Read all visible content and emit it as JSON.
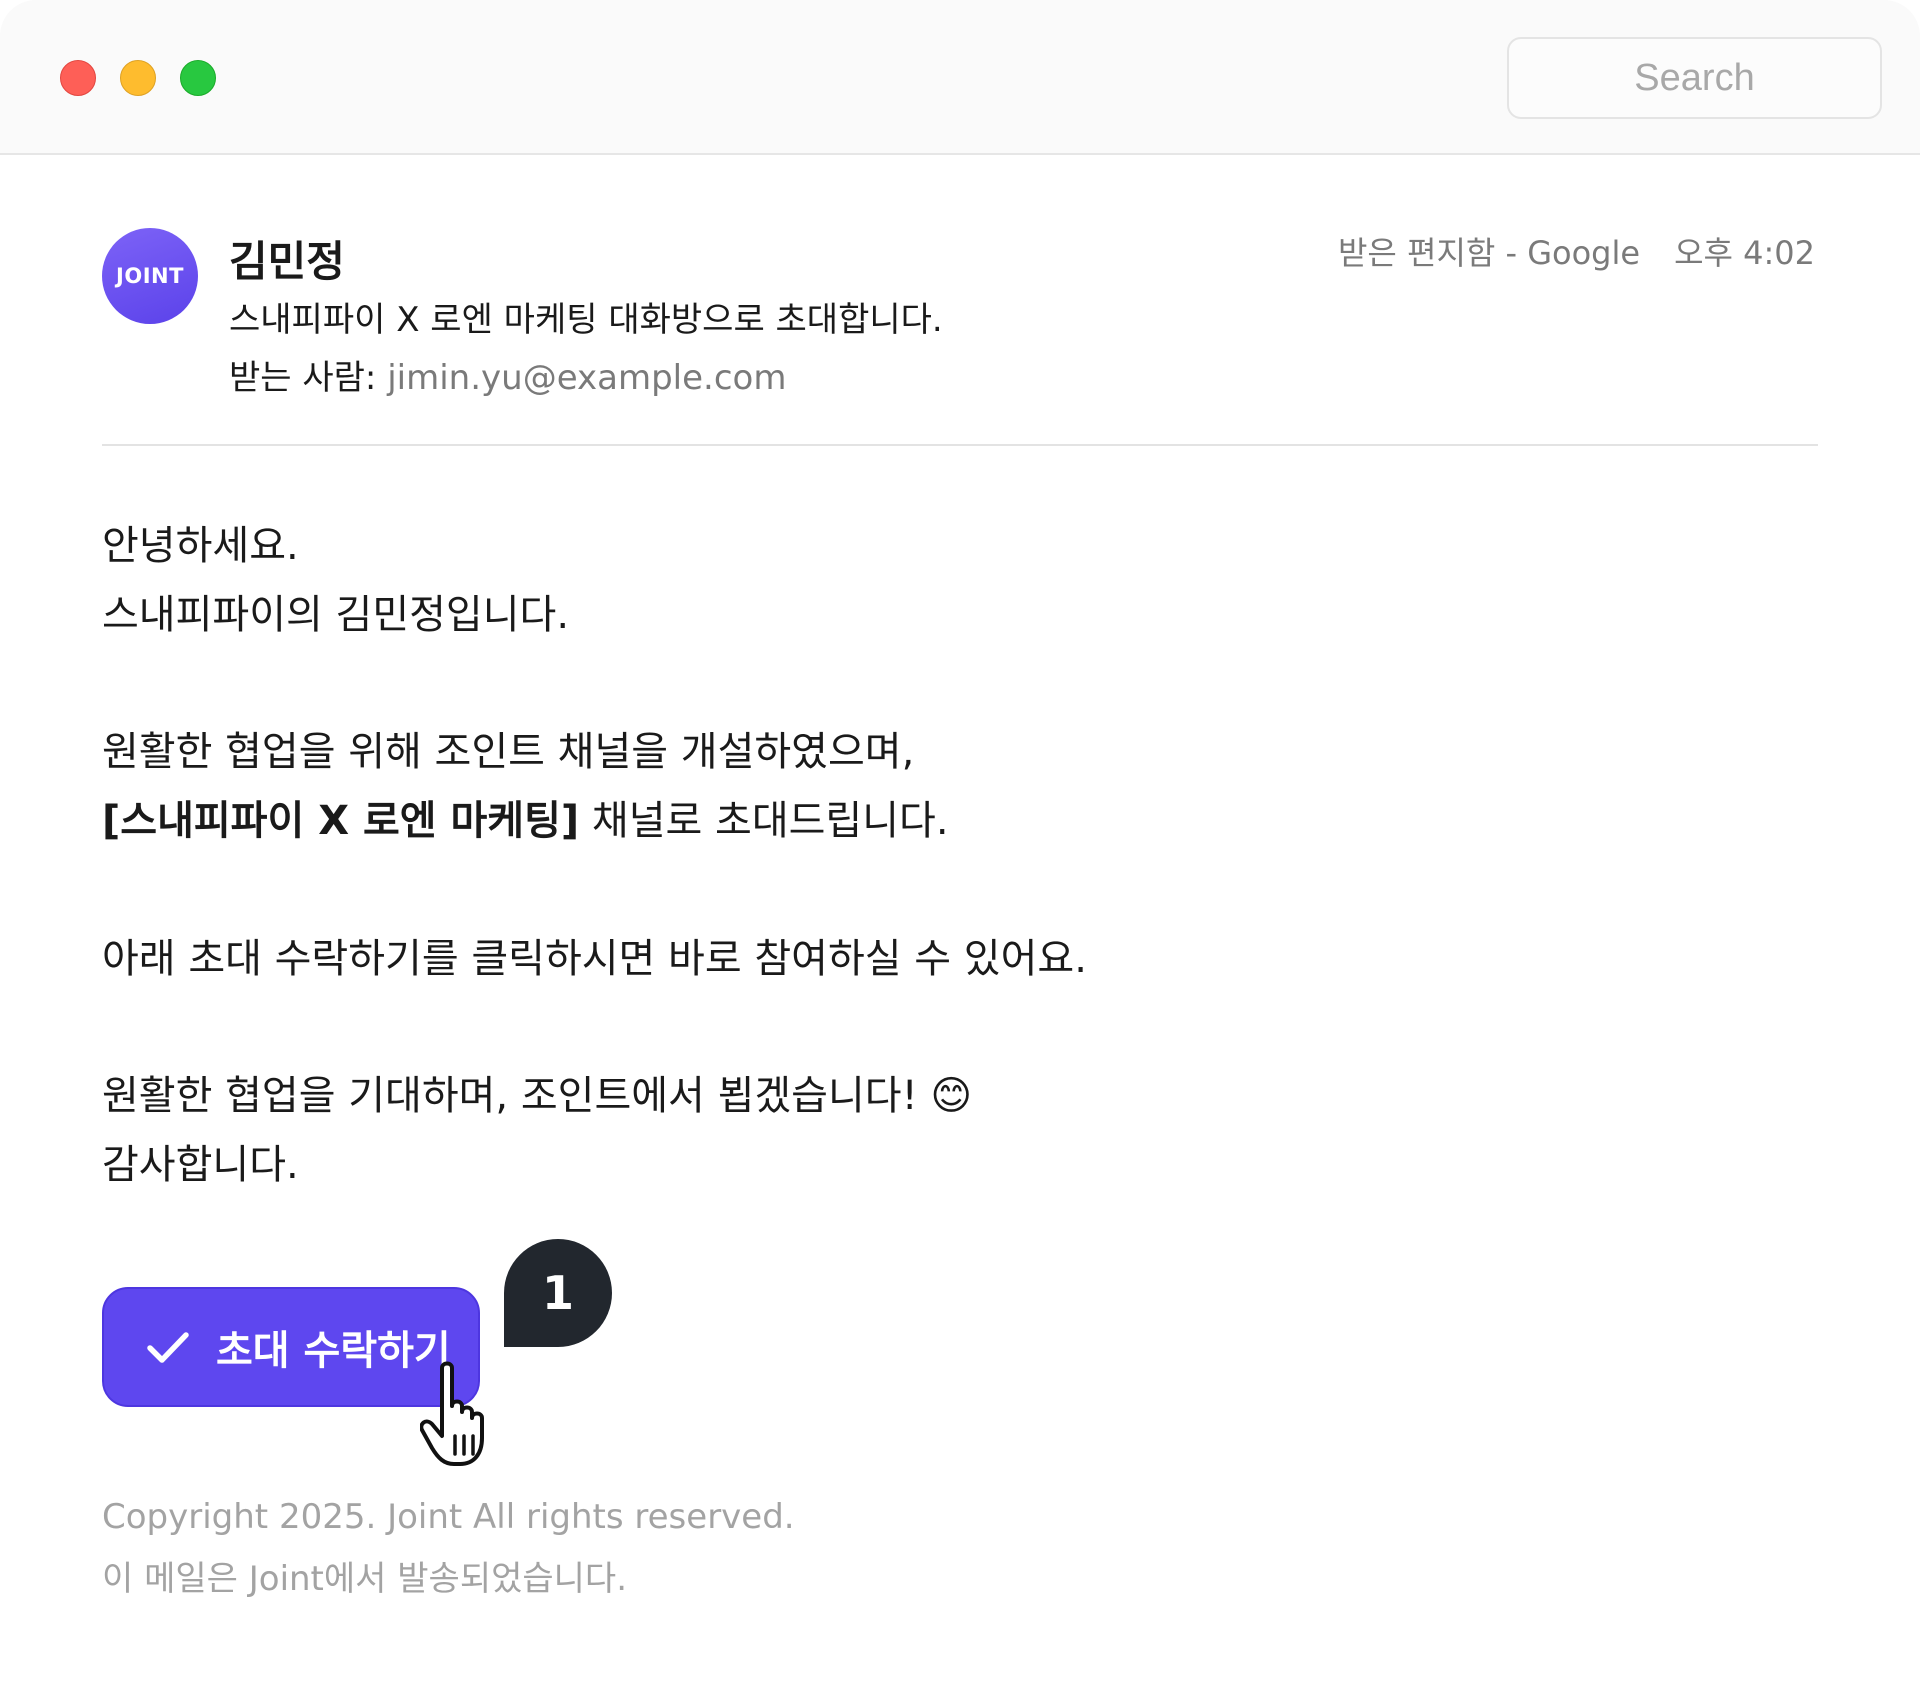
{
  "window": {
    "controls": [
      "close",
      "minimize",
      "maximize"
    ],
    "search_placeholder": "Search"
  },
  "email": {
    "avatar_text": "JOINT",
    "sender": "김민정",
    "subject": "스내피파이 X 로엔 마케팅 대화방으로 초대합니다.",
    "recipient_label": "받는 사람:",
    "recipient_address": "jimin.yu@example.com",
    "mailbox": "받은 편지함 - Google",
    "time": "오후 4:02"
  },
  "body": {
    "line1": "안녕하세요.",
    "line2": "스내피파이의 김민정입니다.",
    "line3": "원활한 협업을 위해 조인트 채널을 개설하였으며,",
    "line4_bold": "[스내피파이 X 로엔 마케팅]",
    "line4_rest": " 채널로 초대드립니다.",
    "line5": "아래 초대 수락하기를 클릭하시면 바로 참여하실 수 있어요.",
    "line6": "원활한 협업을 기대하며, 조인트에서 뵙겠습니다! 😊",
    "line7": "감사합니다."
  },
  "action": {
    "accept_label": "초대 수락하기",
    "step_badge": "1"
  },
  "footer": {
    "copyright": "Copyright 2025. Joint All rights reserved.",
    "note": "이 메일은 Joint에서 발송되었습니다."
  },
  "colors": {
    "accent": "#5e47ef",
    "badge": "#22272e",
    "muted": "#7a7a7a"
  }
}
